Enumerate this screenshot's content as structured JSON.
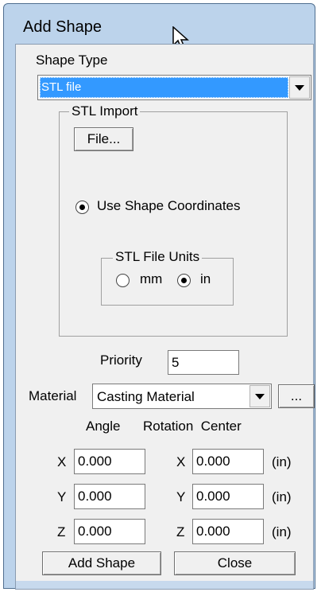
{
  "window": {
    "title": "Add Shape"
  },
  "shape_type": {
    "label": "Shape Type",
    "selected": "STL file"
  },
  "stl_import": {
    "group_label": "STL Import",
    "file_button": "File...",
    "use_shape_coords_label": "Use Shape Coordinates",
    "use_shape_coords_checked": true,
    "units_group_label": "STL File Units",
    "unit_mm_label": "mm",
    "unit_in_label": "in",
    "selected_unit": "in"
  },
  "priority": {
    "label": "Priority",
    "value": "5"
  },
  "material": {
    "label": "Material",
    "selected": "Casting Material",
    "browse_button": "..."
  },
  "angle_header": "Angle",
  "rotation_center_header": "Rotation  Center",
  "angle": {
    "x_label": "X",
    "x_value": "0.000",
    "y_label": "Y",
    "y_value": "0.000",
    "z_label": "Z",
    "z_value": "0.000"
  },
  "center": {
    "x_label": "X",
    "x_value": "0.000",
    "y_label": "Y",
    "y_value": "0.000",
    "z_label": "Z",
    "z_value": "0.000",
    "unit": "(in)"
  },
  "buttons": {
    "add_shape": "Add Shape",
    "close": "Close"
  }
}
